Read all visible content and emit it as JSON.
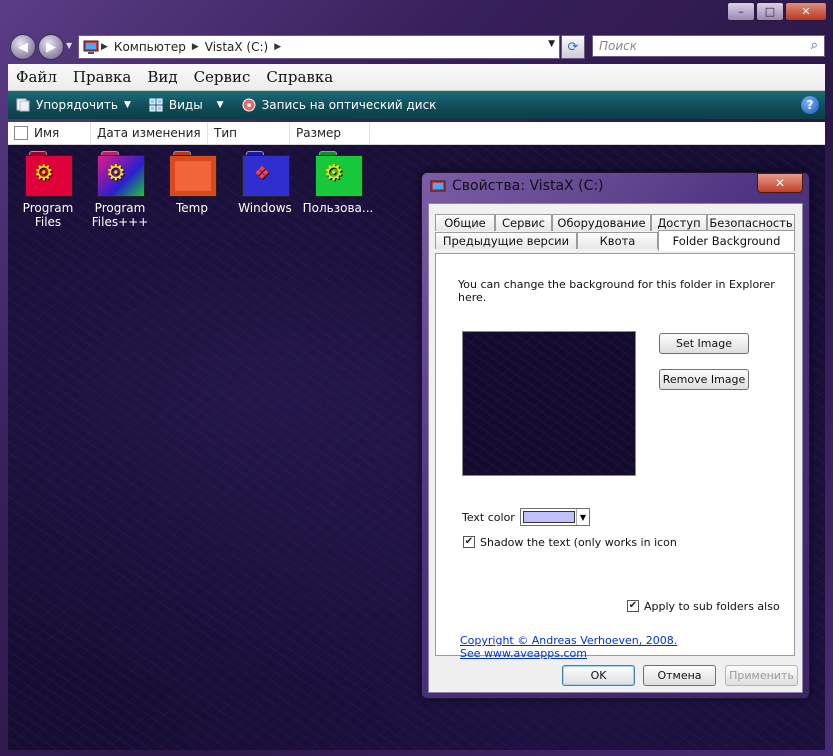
{
  "window": {
    "controls": [
      "–",
      "□",
      "✕"
    ]
  },
  "navbar": {
    "breadcrumb": [
      "Компьютер",
      "VistaX (C:)"
    ],
    "search_placeholder": "Поиск"
  },
  "menubar": [
    "Файл",
    "Правка",
    "Вид",
    "Сервис",
    "Справка"
  ],
  "commandbar": {
    "organize": "Упорядочить",
    "views": "Виды",
    "burn": "Запись на оптический диск",
    "help": "?"
  },
  "columns": [
    "Имя",
    "Дата изменения",
    "Тип",
    "Размер"
  ],
  "files": [
    {
      "name": "Program Files",
      "color": "#e0003a"
    },
    {
      "name": "Program Files+++",
      "color": "#7a1fcf"
    },
    {
      "name": "Temp",
      "color": "#f0663a"
    },
    {
      "name": "Windows",
      "color": "#2f2fd0"
    },
    {
      "name": "Пользова...",
      "color": "#17c93a"
    }
  ],
  "dialog": {
    "title": "Свойства: VistaX (C:)",
    "close": "✕",
    "tabs_row1": [
      "Общие",
      "Сервис",
      "Оборудование",
      "Доступ",
      "Безопасность"
    ],
    "tabs_row2": [
      "Предыдущие версии",
      "Квота",
      "Folder Background"
    ],
    "active_tab": "Folder Background",
    "description": "You can change the background for this folder in Explorer here.",
    "set_image": "Set Image",
    "remove_image": "Remove Image",
    "text_color_label": "Text color",
    "text_color_value": "#c0c0ff",
    "shadow_label": "Shadow the text (only works in icon vie",
    "shadow_checked": true,
    "subfolders_label": "Apply to sub folders also",
    "subfolders_checked": true,
    "copyright": "Copyright © Andreas Verhoeven, 2008. See www.aveapps.com",
    "ok": "OK",
    "cancel": "Отмена",
    "apply": "Применить"
  }
}
